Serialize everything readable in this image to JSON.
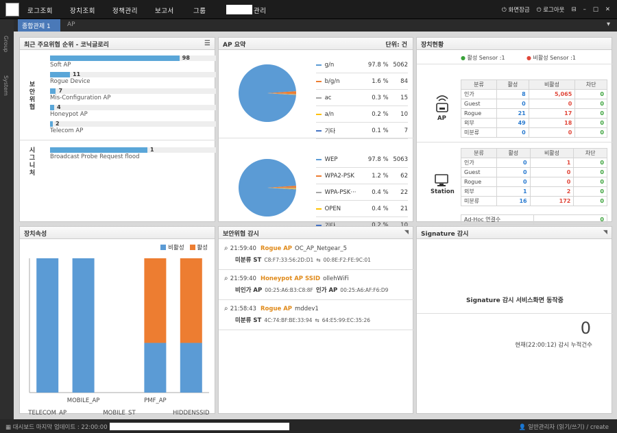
{
  "topbar": {
    "menus": [
      "로그조회",
      "장치조회",
      "정책관리",
      "보고서",
      "그룹"
    ],
    "admin_suffix": "관리",
    "screen_lock": "화면잠금",
    "logout": "로그아웃",
    "win_min": "–",
    "win_max": "□",
    "win_close": "✕",
    "win_pin": "⊟"
  },
  "tabs": {
    "active": "종합관제 1",
    "other": "AP",
    "dropdown": "▾"
  },
  "side": {
    "group": "Group",
    "system": "System"
  },
  "threat": {
    "title": "최근 주요위협 순위 - 코닉글로리",
    "cat1": "보안위협",
    "cat2": "시그니처",
    "items": [
      {
        "name": "Soft AP",
        "value": 98,
        "frac": 0.78
      },
      {
        "name": "Rogue Device",
        "value": 11,
        "frac": 0.12
      },
      {
        "name": "Mis-Configuration AP",
        "value": 7,
        "frac": 0.035
      },
      {
        "name": "Honeypot AP",
        "value": 4,
        "frac": 0.025
      },
      {
        "name": "Telecom AP",
        "value": 2,
        "frac": 0.012
      }
    ],
    "sig_items": [
      {
        "name": "Broadcast Probe Request flood",
        "value": 1,
        "frac": 0.6
      }
    ]
  },
  "apsum": {
    "title": "AP 요약",
    "unit": "단위: 건",
    "pie1": [
      {
        "name": "g/n",
        "pct": "97.8 %",
        "count": "5062",
        "color": "#5b9bd5"
      },
      {
        "name": "b/g/n",
        "pct": "1.6 %",
        "count": "84",
        "color": "#ed7d31"
      },
      {
        "name": "ac",
        "pct": "0.3 %",
        "count": "15",
        "color": "#a5a5a5"
      },
      {
        "name": "a/n",
        "pct": "0.2 %",
        "count": "10",
        "color": "#ffc000"
      },
      {
        "name": "기타",
        "pct": "0.1 %",
        "count": "7",
        "color": "#4472c4"
      }
    ],
    "pie2": [
      {
        "name": "WEP",
        "pct": "97.8 %",
        "count": "5063",
        "color": "#5b9bd5"
      },
      {
        "name": "WPA2-PSK",
        "pct": "1.2 %",
        "count": "62",
        "color": "#ed7d31"
      },
      {
        "name": "WPA-PSK···",
        "pct": "0.4 %",
        "count": "22",
        "color": "#a5a5a5"
      },
      {
        "name": "OPEN",
        "pct": "0.4 %",
        "count": "21",
        "color": "#ffc000"
      },
      {
        "name": "기타",
        "pct": "0.2 %",
        "count": "10",
        "color": "#4472c4"
      }
    ]
  },
  "devstat": {
    "title": "장치현황",
    "active_sensor": "활성 Sensor :1",
    "inactive_sensor": "비활성 Sensor :1",
    "ap_label": "AP",
    "station_label": "Station",
    "headers": [
      "분류",
      "활성",
      "비활성",
      "차단"
    ],
    "ap_rows": [
      [
        "인가",
        "8",
        "5,065",
        "0"
      ],
      [
        "Guest",
        "0",
        "0",
        "0"
      ],
      [
        "Rogue",
        "21",
        "17",
        "0"
      ],
      [
        "외부",
        "49",
        "18",
        "0"
      ],
      [
        "미분류",
        "0",
        "0",
        "0"
      ]
    ],
    "st_rows": [
      [
        "인가",
        "0",
        "1",
        "0"
      ],
      [
        "Guest",
        "0",
        "0",
        "0"
      ],
      [
        "Rogue",
        "0",
        "0",
        "0"
      ],
      [
        "외부",
        "1",
        "2",
        "0"
      ],
      [
        "미분류",
        "16",
        "172",
        "0"
      ]
    ],
    "adhoc_label": "Ad-Hoc 연결수",
    "adhoc_value": "0"
  },
  "attr": {
    "title": "장치속성",
    "legend_inactive": "비활성",
    "legend_active": "활성"
  },
  "chart_data": {
    "type": "bar",
    "stacked": true,
    "categories": [
      "TELECOM_AP",
      "MOBILE_AP",
      "MOBILE_ST",
      "PMF_AP",
      "HIDDENSSID"
    ],
    "series": [
      {
        "name": "비활성",
        "values": [
          100,
          100,
          0,
          37,
          37
        ],
        "color": "#5b9bd5"
      },
      {
        "name": "활성",
        "values": [
          0,
          0,
          0,
          63,
          63
        ],
        "color": "#ed7d31"
      }
    ],
    "ylim": [
      0,
      100
    ],
    "grid": false,
    "legend": "top-right"
  },
  "secmon": {
    "title": "보안위협 감시",
    "events": [
      {
        "time": "21:59:40",
        "type": "Rogue AP",
        "detail": "OC_AP_Netgear_5",
        "l2cls": "미분류 ST",
        "mac1": "C8:F7:33:56:2D:D1",
        "mac2": "00:8E:F2:FE:9C:01"
      },
      {
        "time": "21:59:40",
        "type": "Honeypot AP SSID",
        "detail": "ollehWiFi",
        "l2cls": "비인가 AP",
        "mac1": "00:25:A6:B3:C8:8F",
        "l2cls2": "인가 AP",
        "mac2": "00:25:A6:AF:F6:D9"
      },
      {
        "time": "21:58:43",
        "type": "Rogue AP",
        "detail": "mddev1",
        "l2cls": "미분류 ST",
        "mac1": "4C:74:BF:BE:33:94",
        "mac2": "64:E5:99:EC:35:26"
      }
    ]
  },
  "sigmon": {
    "title": "Signature 감시",
    "message": "Signature 감시 서비스화면 동작중",
    "count": "0",
    "sub": "현재(22:00:12) 감시 누적건수"
  },
  "bottom": {
    "left": "대시보드 마지막 업데이트 : 22:00:00",
    "right": "일반관리자 (읽기/쓰기) / create"
  }
}
